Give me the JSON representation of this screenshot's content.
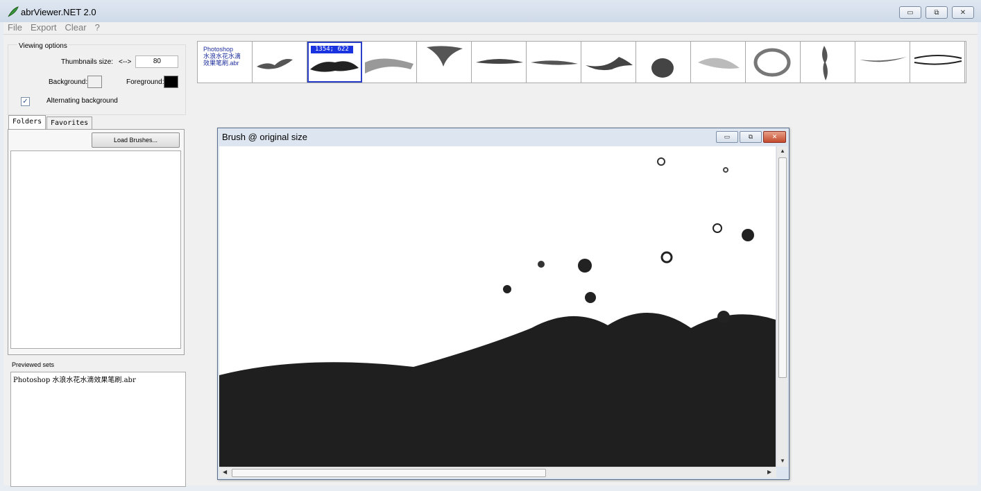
{
  "window": {
    "title": "abrViewer.NET 2.0",
    "min_glyph": "▭",
    "max_glyph": "⧉",
    "close_glyph": "✕"
  },
  "menu": [
    {
      "label": "File"
    },
    {
      "label": "Export"
    },
    {
      "label": "Clear"
    },
    {
      "label": "?"
    }
  ],
  "viewing_options": {
    "legend": "Viewing options",
    "thumb_size_label": "Thumbnails size:",
    "thumb_size_arrow": "<-->",
    "thumb_size_value": "80",
    "background_label": "Background:",
    "background_color": "#f0f0f0",
    "foreground_label": "Foreground:",
    "foreground_color": "#000000",
    "alternating_label": "Alternating background",
    "alternating_checked": true
  },
  "tabs": [
    {
      "label": "Folders",
      "active": true
    },
    {
      "label": "Favorites",
      "active": false
    }
  ],
  "folders": {
    "load_button": "Load Brushes..."
  },
  "previewed": {
    "label": "Previewed sets",
    "items": [
      "Photoshop 水浪水花水滴效果笔刷.abr"
    ]
  },
  "strip": {
    "set_title_lines": [
      "Photoshop",
      "水浪水花水滴",
      "效果笔刷.abr"
    ],
    "selected_label": "1354; 622",
    "brush_icons": [
      "splash-brush-icon",
      "wave-splash-brush-icon",
      "spray-brush-icon",
      "splash-funnel-brush-icon",
      "ripple-brush-icon",
      "ripple-brush-icon",
      "wave-curl-brush-icon",
      "drop-brush-icon",
      "mist-brush-icon",
      "swirl-brush-icon",
      "drip-brush-icon",
      "wave-brush-icon",
      "signature-brush-icon"
    ]
  },
  "preview_window": {
    "title": "Brush @ original size",
    "min_glyph": "▭",
    "max_glyph": "⧉",
    "close_glyph": "✕"
  },
  "accent_colors": {
    "selection": "#1a33e0",
    "set_title": "#1c2e9c"
  }
}
